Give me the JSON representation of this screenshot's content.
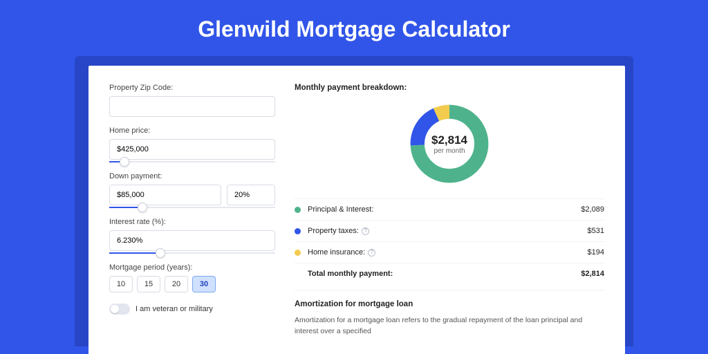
{
  "title": "Glenwild Mortgage Calculator",
  "form": {
    "zip_label": "Property Zip Code:",
    "zip_value": "",
    "home_price_label": "Home price:",
    "home_price_value": "$425,000",
    "home_price_pct": 9,
    "down_payment_label": "Down payment:",
    "down_payment_value": "$85,000",
    "down_payment_pct_value": "20%",
    "down_payment_slider_pct": 20,
    "rate_label": "Interest rate (%):",
    "rate_value": "6.230%",
    "rate_slider_pct": 31,
    "period_label": "Mortgage period (years):",
    "periods": [
      "10",
      "15",
      "20",
      "30"
    ],
    "period_selected": "30",
    "veteran_label": "I am veteran or military"
  },
  "breakdown": {
    "title": "Monthly payment breakdown:",
    "center_amount": "$2,814",
    "center_sub": "per month",
    "items": [
      {
        "label": "Principal & Interest:",
        "value": "$2,089",
        "color": "#4eb38c",
        "info": false,
        "pct": 74.2
      },
      {
        "label": "Property taxes:",
        "value": "$531",
        "color": "#3055e8",
        "info": true,
        "pct": 18.9
      },
      {
        "label": "Home insurance:",
        "value": "$194",
        "color": "#f3cc4f",
        "info": true,
        "pct": 6.9
      }
    ],
    "total_label": "Total monthly payment:",
    "total_value": "$2,814"
  },
  "amort": {
    "title": "Amortization for mortgage loan",
    "body": "Amortization for a mortgage loan refers to the gradual repayment of the loan principal and interest over a specified"
  },
  "chart_data": {
    "type": "pie",
    "title": "Monthly payment breakdown",
    "total_label": "$2,814 per month",
    "series": [
      {
        "name": "Principal & Interest",
        "value": 2089,
        "color": "#4eb38c"
      },
      {
        "name": "Property taxes",
        "value": 531,
        "color": "#3055e8"
      },
      {
        "name": "Home insurance",
        "value": 194,
        "color": "#f3cc4f"
      }
    ]
  }
}
